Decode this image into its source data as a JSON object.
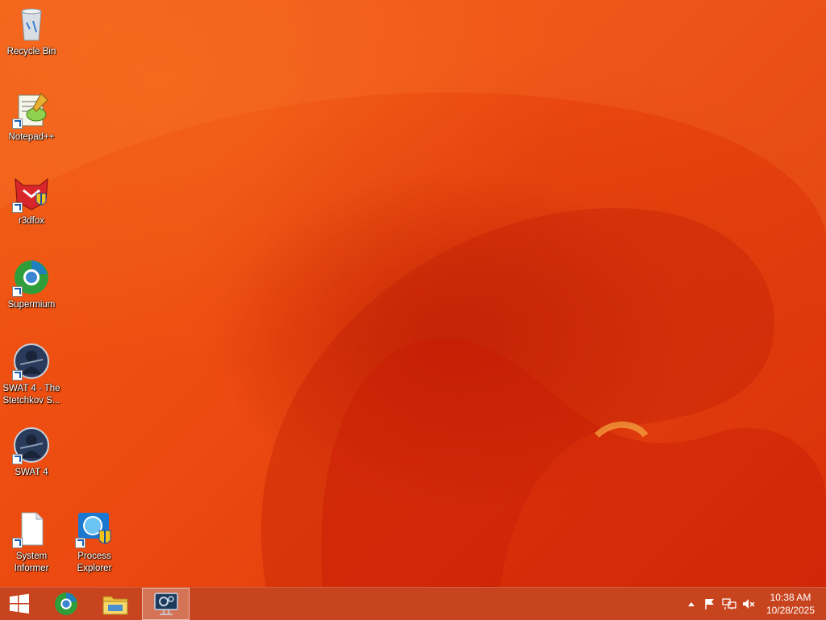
{
  "desktop": {
    "icons": [
      {
        "label": "Recycle Bin"
      },
      {
        "label": "Notepad++"
      },
      {
        "label": "r3dfox"
      },
      {
        "label": "Supermium"
      },
      {
        "label": "SWAT 4 - The Stetchkov S..."
      },
      {
        "label": "SWAT 4"
      },
      {
        "label": "System Informer"
      },
      {
        "label": "Process Explorer"
      }
    ]
  },
  "taskbar": {
    "start_icon": "windows-logo-icon",
    "pinned": [
      {
        "name": "supermium-icon"
      },
      {
        "name": "file-explorer-icon"
      },
      {
        "name": "system-settings-icon",
        "active": true
      }
    ],
    "tray": {
      "icons": [
        "show-hidden-icons",
        "action-center-flag-icon",
        "network-icon",
        "volume-muted-icon"
      ]
    },
    "clock": {
      "time": "10:38 AM",
      "date": "10/28/2025"
    }
  },
  "colors": {
    "wallpaper": "#e8420e",
    "taskbar": "#c7441f"
  }
}
